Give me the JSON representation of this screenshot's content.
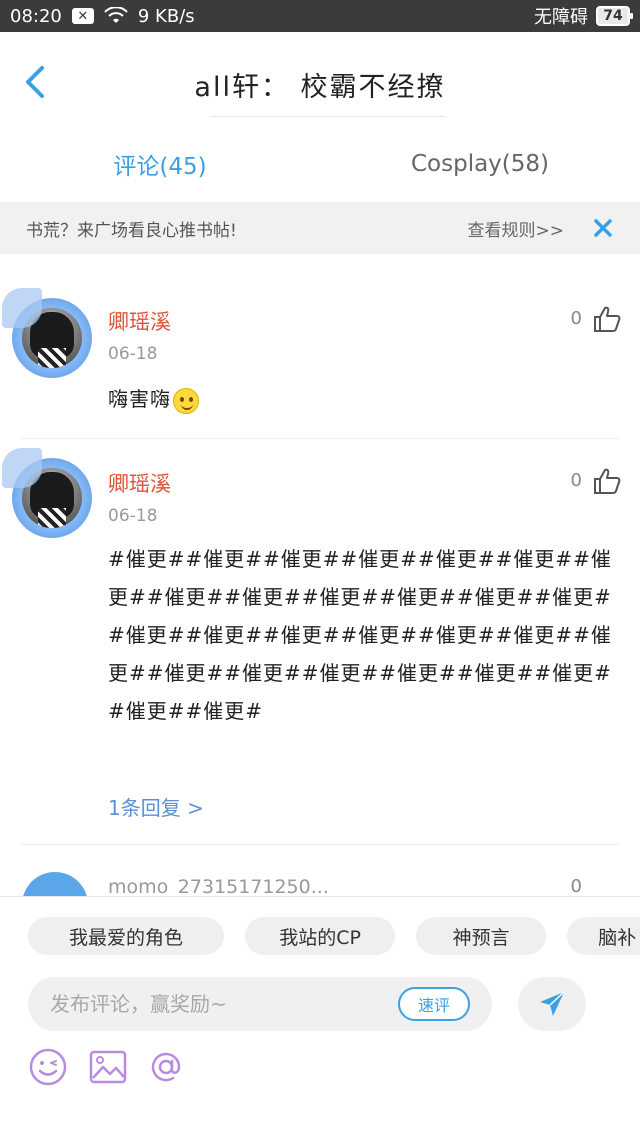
{
  "status_bar": {
    "time": "08:20",
    "speed": "9 KB/s",
    "accessibility": "无障碍",
    "battery": "74"
  },
  "header": {
    "title": "all轩： 校霸不经撩"
  },
  "tabs": [
    {
      "label": "评论(45)",
      "active": true
    },
    {
      "label": "Cosplay(58)",
      "active": false
    }
  ],
  "notice": {
    "text": "书荒？来广场看良心推书帖!",
    "rules": "查看规则>>"
  },
  "comments": [
    {
      "username": "卿瑶溪",
      "date": "06-18",
      "likes": "0",
      "text": "嗨害嗨"
    },
    {
      "username": "卿瑶溪",
      "date": "06-18",
      "likes": "0",
      "text": "#催更##催更##催更##催更##催更##催更##催更##催更##催更##催更##催更##催更##催更##催更##催更##催更##催更##催更##催更##催更##催更##催更##催更##催更##催更##催更##催更##催更#",
      "replies": "1条回复 >"
    },
    {
      "username": "momo_27315171250...",
      "likes": "0"
    }
  ],
  "quick_tags": [
    "我最爱的角色",
    "我站的CP",
    "神预言",
    "脑补"
  ],
  "composer": {
    "placeholder": "发布评论，赢奖励~",
    "quick_review": "速评"
  },
  "colors": {
    "accent": "#3aa0e4",
    "username": "#e0533a",
    "reply_link": "#5b8fd6",
    "tool_icon": "#b98be0"
  }
}
